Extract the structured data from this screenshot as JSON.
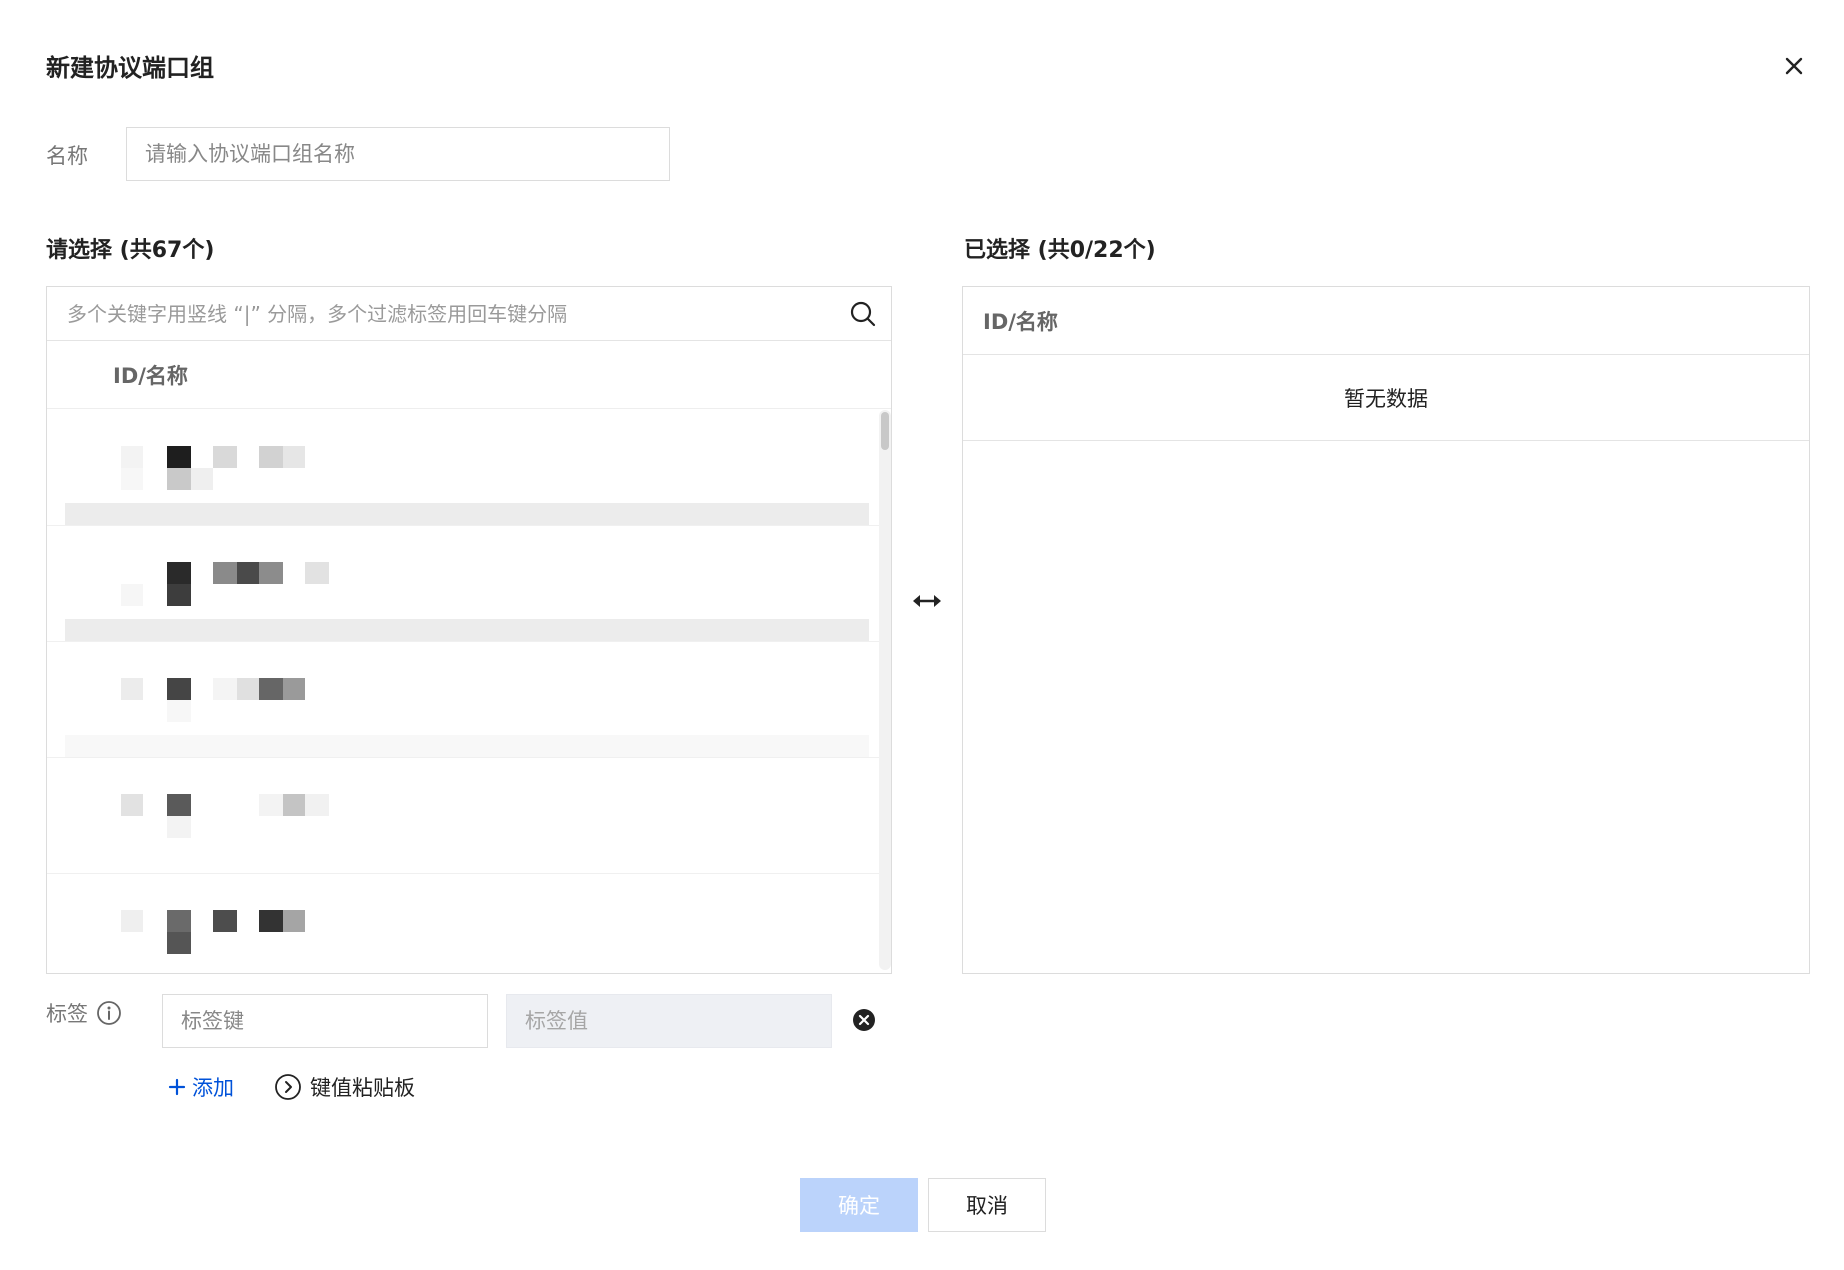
{
  "dialog": {
    "title": "新建协议端口组"
  },
  "name_field": {
    "label": "名称",
    "placeholder": "请输入协议端口组名称",
    "value": ""
  },
  "available_panel": {
    "title": "请选择 (共67个)",
    "search_placeholder": "多个关键字用竖线 “|” 分隔，多个过滤标签用回车键分隔",
    "column_header": "ID/名称",
    "visible_row_count": 5
  },
  "selected_panel": {
    "title": "已选择 (共0/22个)",
    "column_header": "ID/名称",
    "empty_text": "暂无数据"
  },
  "tags": {
    "label": "标签",
    "key_placeholder": "标签键",
    "value_placeholder": "标签值",
    "add_label": "添加",
    "clipboard_label": "键值粘贴板"
  },
  "footer": {
    "confirm_label": "确定",
    "cancel_label": "取消"
  },
  "colors": {
    "accent": "#0052d9",
    "confirm_disabled_bg": "#bbd3fb",
    "border": "#dcdcdc"
  }
}
